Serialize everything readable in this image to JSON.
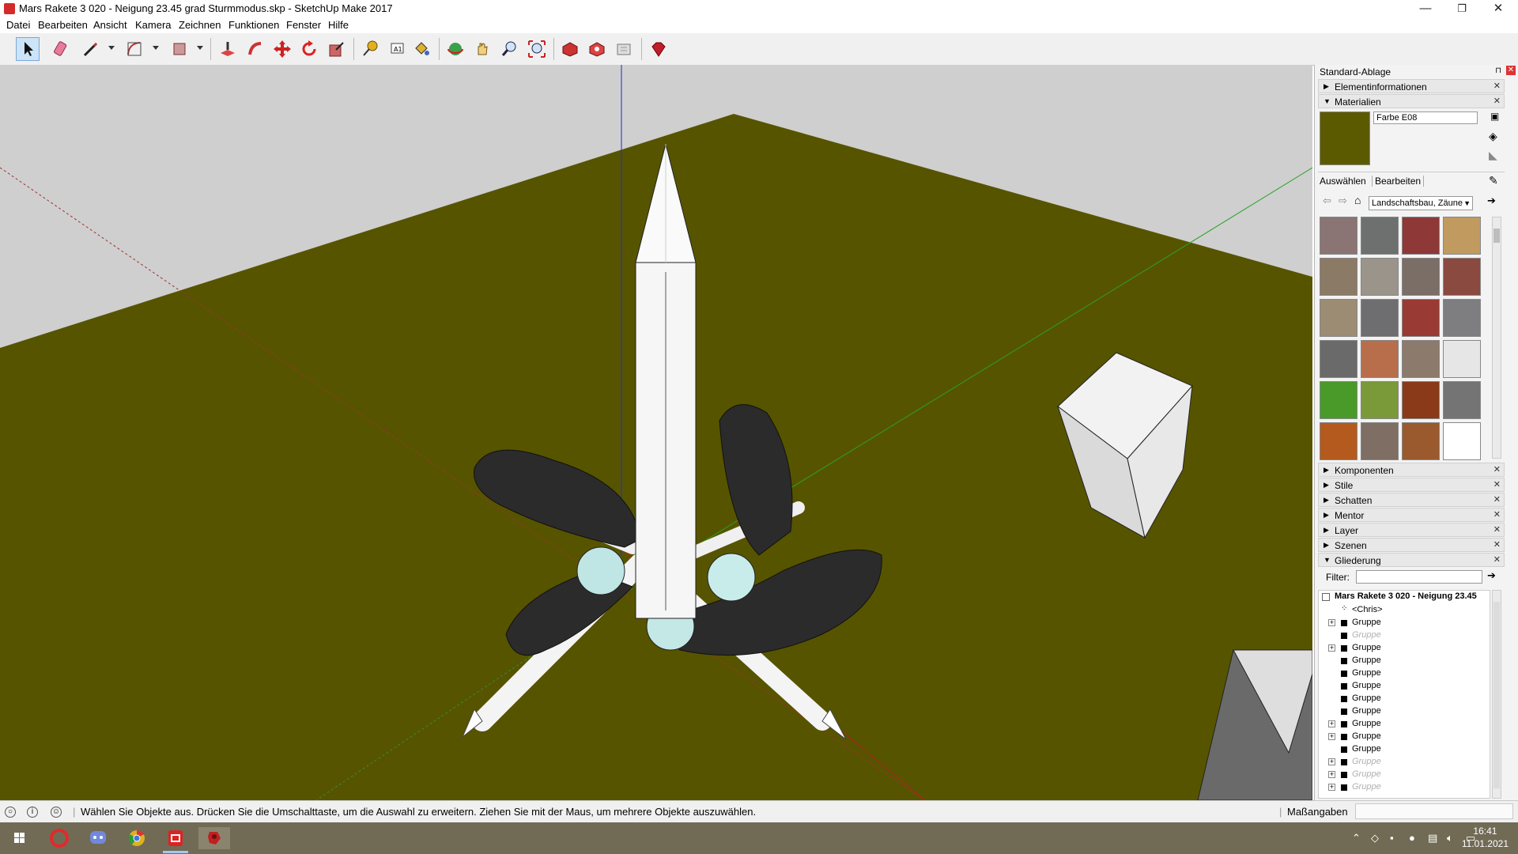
{
  "window": {
    "title": "Mars Rakete 3 020 - Neigung 23.45 grad Sturmmodus.skp - SketchUp Make 2017",
    "minimize": "—",
    "maximize": "❐",
    "close": "✕"
  },
  "menu": [
    "Datei",
    "Bearbeiten",
    "Ansicht",
    "Kamera",
    "Zeichnen",
    "Funktionen",
    "Fenster",
    "Hilfe"
  ],
  "toolbar": {
    "tools": [
      "select-icon",
      "eraser-icon",
      "pencil-icon",
      "arc-icon",
      "rectangle-icon",
      "push-pull-icon",
      "follow-me-icon",
      "move-icon",
      "rotate-icon",
      "scale-icon",
      "tape-measure-icon",
      "text-icon",
      "paint-bucket-icon",
      "orbit-icon",
      "pan-icon",
      "zoom-icon",
      "zoom-extents-icon",
      "warehouse-icon",
      "extension-warehouse-icon",
      "share-model-icon",
      "ruby-icon"
    ]
  },
  "tray": {
    "title": "Standard-Ablage",
    "panels_top": {
      "element_info": "Elementinformationen",
      "materials": "Materialien"
    },
    "material": {
      "name": "Farbe E08",
      "color": "#5c5a00",
      "tab_select": "Auswählen",
      "tab_edit": "Bearbeiten",
      "library": "Landschaftsbau, Zäune",
      "swatches": [
        "#8a7474",
        "#6e7070",
        "#8e3838",
        "#c09a5e",
        "#8a7a66",
        "#9a948a",
        "#7a6e66",
        "#8a4a40",
        "#9c8c74",
        "#6e6e70",
        "#9a3a34",
        "#7e7e80",
        "#6a6a6a",
        "#b86e4a",
        "#8c7a6c",
        "#e6e6e6",
        "#4a9a2a",
        "#7a9a3a",
        "#8a3a18",
        "#747474",
        "#b45a1e",
        "#7e6e64",
        "#9a5a2e",
        "#ffffff"
      ]
    },
    "panels": [
      "Komponenten",
      "Stile",
      "Schatten",
      "Mentor",
      "Layer",
      "Szenen",
      "Gliederung"
    ],
    "outliner": {
      "filter_label": "Filter:",
      "root": "Mars Rakete 3 020 - Neigung 23.45",
      "items": [
        {
          "label": "<Chris>",
          "dim": false,
          "plus": false
        },
        {
          "label": "Gruppe",
          "dim": false,
          "plus": true
        },
        {
          "label": "Gruppe",
          "dim": true,
          "plus": false
        },
        {
          "label": "Gruppe",
          "dim": false,
          "plus": true
        },
        {
          "label": "Gruppe",
          "dim": false,
          "plus": false
        },
        {
          "label": "Gruppe",
          "dim": false,
          "plus": false
        },
        {
          "label": "Gruppe",
          "dim": false,
          "plus": false
        },
        {
          "label": "Gruppe",
          "dim": false,
          "plus": false
        },
        {
          "label": "Gruppe",
          "dim": false,
          "plus": false
        },
        {
          "label": "Gruppe",
          "dim": false,
          "plus": true
        },
        {
          "label": "Gruppe",
          "dim": false,
          "plus": true
        },
        {
          "label": "Gruppe",
          "dim": false,
          "plus": false
        },
        {
          "label": "Gruppe",
          "dim": true,
          "plus": true
        },
        {
          "label": "Gruppe",
          "dim": true,
          "plus": true
        },
        {
          "label": "Gruppe",
          "dim": true,
          "plus": true
        }
      ]
    }
  },
  "status": {
    "message": "Wählen Sie Objekte aus. Drücken Sie die Umschalttaste, um die Auswahl zu erweitern. Ziehen Sie mit der Maus, um mehrere Objekte auszuwählen.",
    "measure_label": "Maßangaben"
  },
  "taskbar": {
    "time": "16:41",
    "date": "11.01.2021"
  },
  "colors": {
    "ground": "#575400",
    "sky": "#cfcfcf"
  }
}
